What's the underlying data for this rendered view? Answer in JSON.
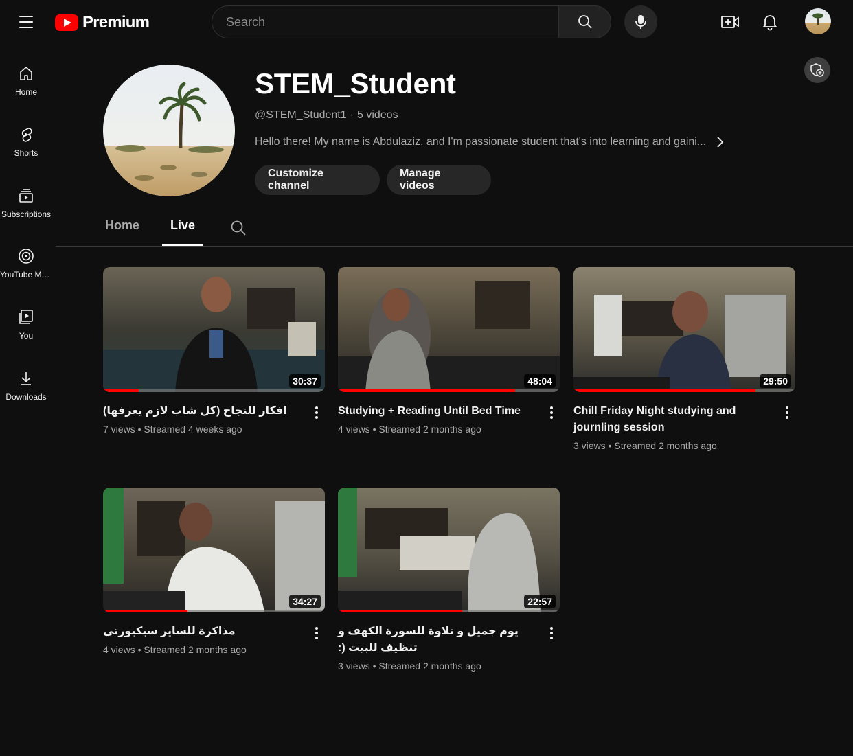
{
  "topbar": {
    "brand": "Premium",
    "search_placeholder": "Search",
    "icons": [
      "menu-icon",
      "youtube-logo-icon",
      "search-icon",
      "mic-icon",
      "create-icon",
      "notifications-icon",
      "account-avatar"
    ]
  },
  "sidebar": {
    "items": [
      {
        "label": "Home",
        "icon": "home-icon"
      },
      {
        "label": "Shorts",
        "icon": "shorts-icon"
      },
      {
        "label": "Subscriptions",
        "icon": "subscriptions-icon"
      },
      {
        "label": "YouTube Mu...",
        "icon": "youtube-music-icon"
      },
      {
        "label": "You",
        "icon": "you-icon"
      },
      {
        "label": "Downloads",
        "icon": "download-icon"
      }
    ]
  },
  "channel": {
    "name": "STEM_Student",
    "handle": "@STEM_Student1",
    "separator": "·",
    "video_count": "5 videos",
    "description": "Hello there! My name is Abdulaziz, and I'm passionate student that's into learning and gaini...",
    "customize_label": "Customize channel",
    "manage_label": "Manage videos"
  },
  "tabs": [
    {
      "label": "Home",
      "active": false
    },
    {
      "label": "Live",
      "active": true
    }
  ],
  "videos": [
    {
      "title": "افكار للنجاح (كل شاب لازم يعرفها)",
      "views": "7 views",
      "streamed": "Streamed 4 weeks ago",
      "duration": "30:37",
      "progress": 0.16
    },
    {
      "title": "Studying + Reading Until Bed Time",
      "views": "4 views",
      "streamed": "Streamed 2 months ago",
      "duration": "48:04",
      "progress": 0.8
    },
    {
      "title": "Chill Friday Night studying and journling session",
      "views": "3 views",
      "streamed": "Streamed 2 months ago",
      "duration": "29:50",
      "progress": 0.82
    },
    {
      "title": "مذاكرة للساير سيكيورتي",
      "views": "4 views",
      "streamed": "Streamed 2 months ago",
      "duration": "34:27",
      "progress": 0.38
    },
    {
      "title": "يوم جميل و تلاوة للسورة الكهف و تنظيف للبيت (:",
      "views": "3 views",
      "streamed": "Streamed 2 months ago",
      "duration": "22:57",
      "progress": 0.56
    }
  ],
  "colors": {
    "background": "#0f0f0f",
    "accent": "#ff0000",
    "pill": "#272727",
    "secondary_text": "#aaaaaa"
  }
}
